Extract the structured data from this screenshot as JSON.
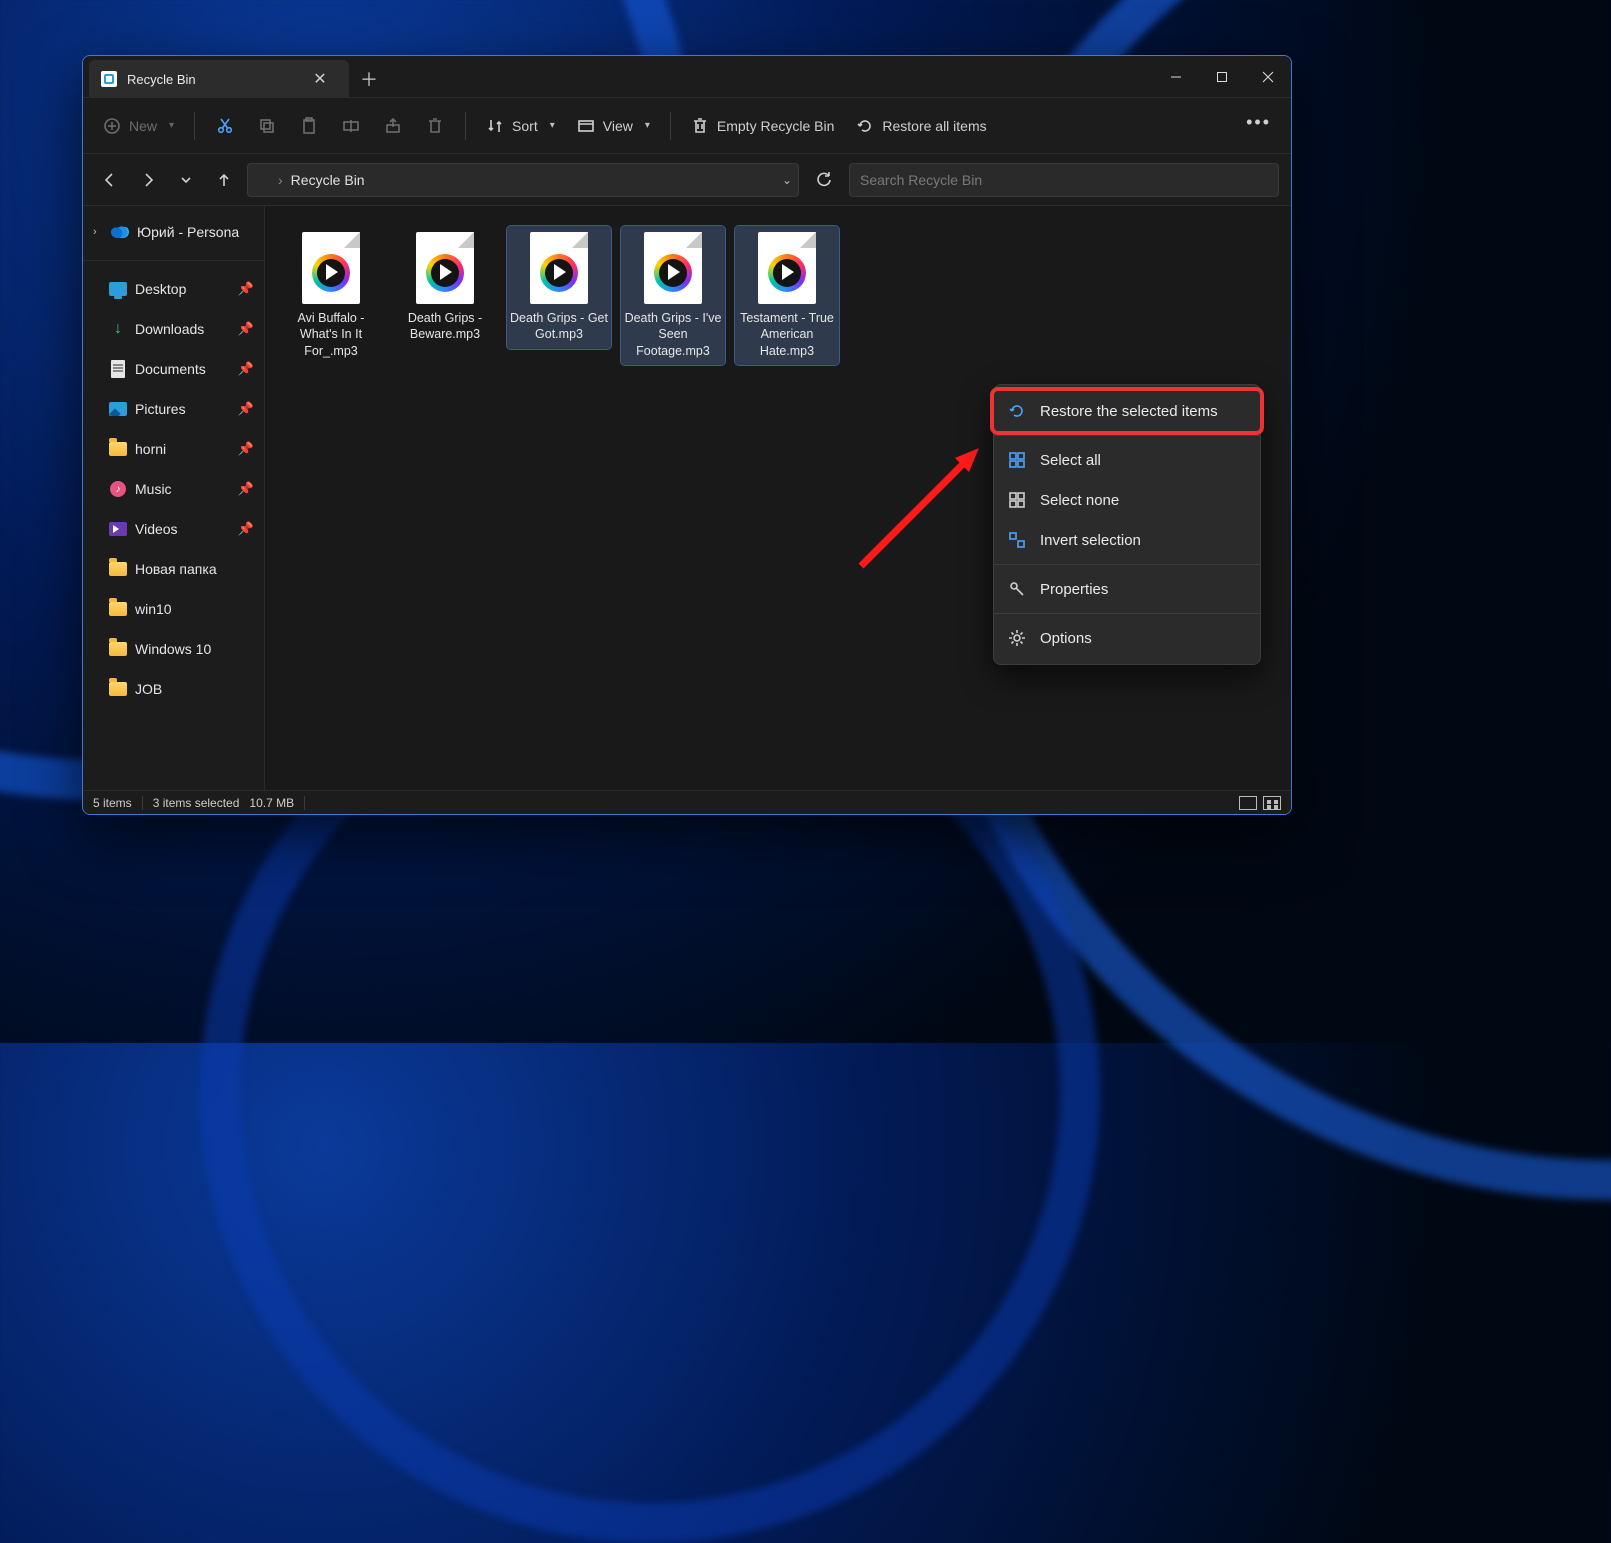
{
  "tab": {
    "title": "Recycle Bin"
  },
  "toolbar": {
    "new": "New",
    "sort": "Sort",
    "view": "View",
    "empty": "Empty Recycle Bin",
    "restore_all": "Restore all items"
  },
  "address": {
    "location": "Recycle Bin"
  },
  "search": {
    "placeholder": "Search Recycle Bin"
  },
  "tree": {
    "onedrive": "Юрий - Persona",
    "desktop": "Desktop",
    "downloads": "Downloads",
    "documents": "Documents",
    "pictures": "Pictures",
    "horni": "horni",
    "music": "Music",
    "videos": "Videos",
    "folder1": "Новая папка",
    "folder2": "win10",
    "folder3": "Windows 10",
    "folder4": "JOB"
  },
  "files": [
    {
      "name": "Avi Buffalo - What's In It For_.mp3",
      "selected": false
    },
    {
      "name": "Death Grips - Beware.mp3",
      "selected": false
    },
    {
      "name": "Death Grips - Get Got.mp3",
      "selected": true
    },
    {
      "name": "Death Grips - I've Seen Footage.mp3",
      "selected": true
    },
    {
      "name": "Testament - True American Hate.mp3",
      "selected": true
    }
  ],
  "status": {
    "count": "5 items",
    "selected": "3 items selected",
    "size": "10.7 MB"
  },
  "menu": {
    "restore_selected": "Restore the selected items",
    "select_all": "Select all",
    "select_none": "Select none",
    "invert": "Invert selection",
    "properties": "Properties",
    "options": "Options"
  }
}
